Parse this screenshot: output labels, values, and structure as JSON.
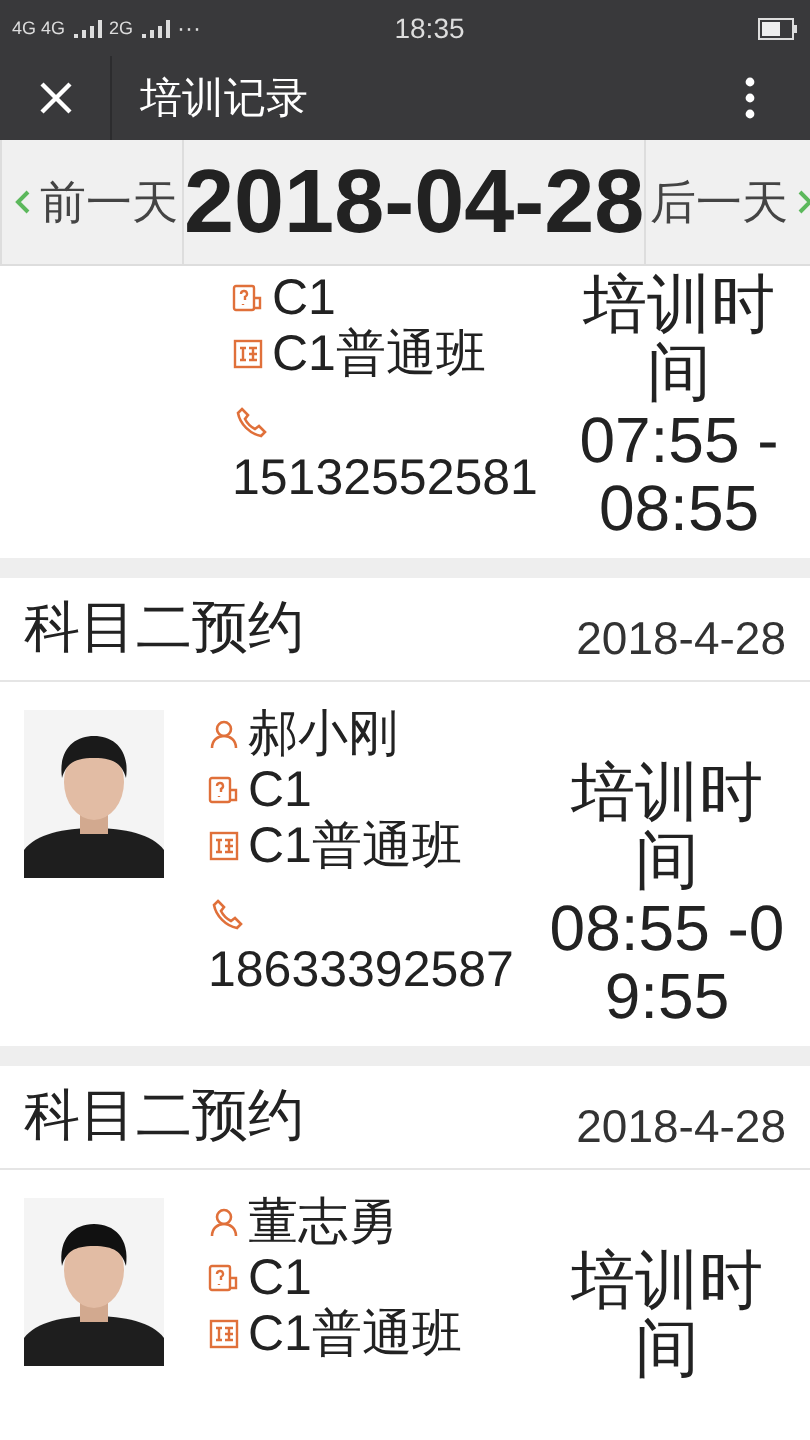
{
  "status_bar": {
    "network": "4G 4G",
    "network_2": "2G",
    "more": "···",
    "time": "18:35"
  },
  "title_bar": {
    "title": "培训记录"
  },
  "date_nav": {
    "prev": "前一天",
    "date": "2018-04-28",
    "next": "后一天"
  },
  "records": [
    {
      "license": "C1",
      "class": "C1普通班",
      "phone": "15132552581",
      "time_label": "培训时间",
      "time": "07:55 -08:55"
    },
    {
      "subject": "科目二预约",
      "date": "2018-4-28",
      "name": "郝小刚",
      "license": "C1",
      "class": "C1普通班",
      "phone": "18633392587",
      "time_label": "培训时间",
      "time": "08:55 -09:55"
    },
    {
      "subject": "科目二预约",
      "date": "2018-4-28",
      "name": "董志勇",
      "license": "C1",
      "class": "C1普通班",
      "time_label": "培训时间"
    }
  ]
}
